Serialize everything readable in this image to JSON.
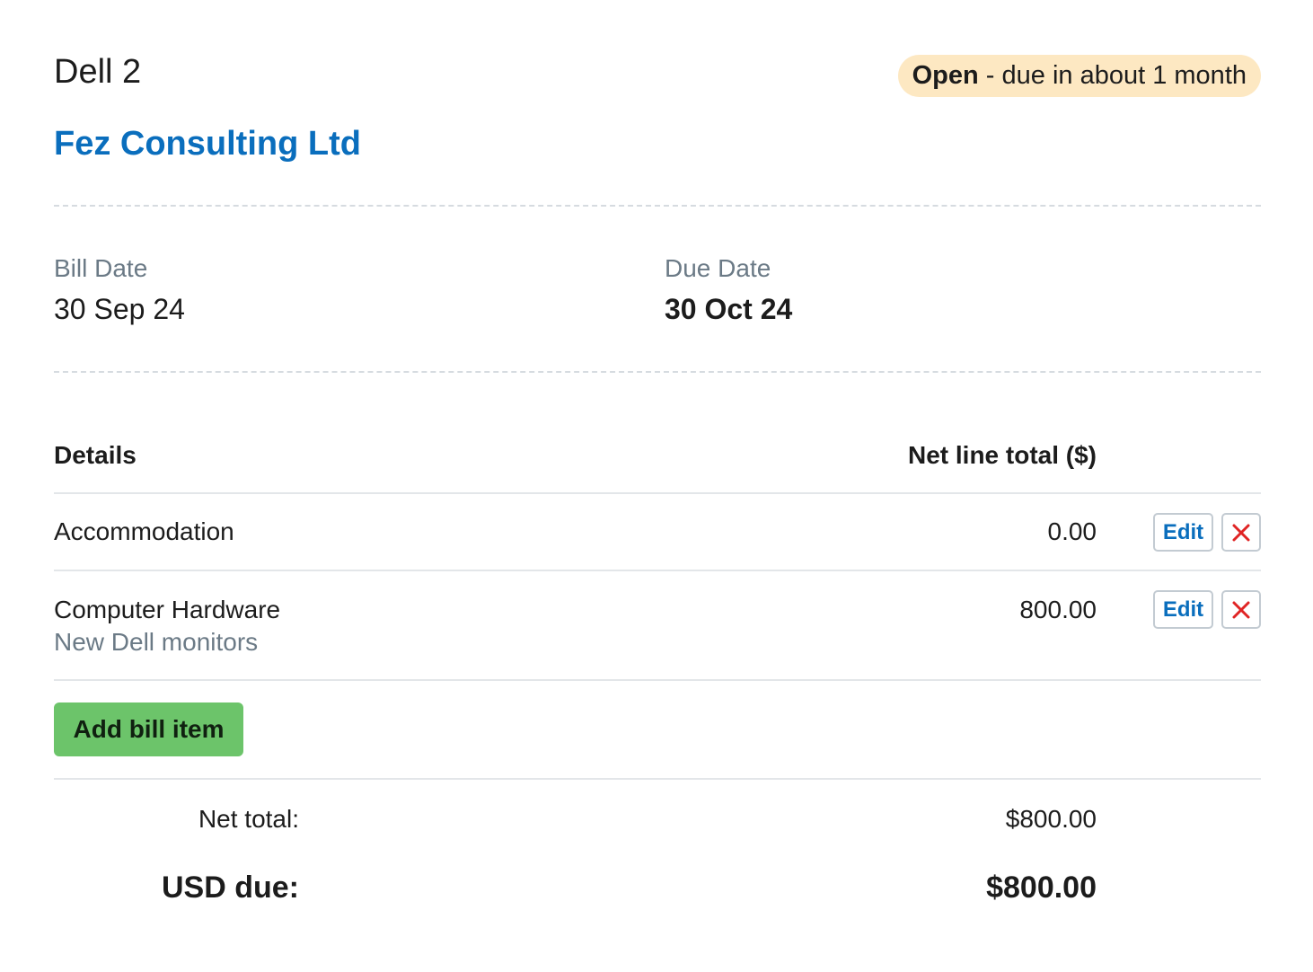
{
  "bill": {
    "title": "Dell 2",
    "status": {
      "label": "Open",
      "separator": " - ",
      "text": "due in about 1 month",
      "color": "#fde8c2"
    },
    "contact": "Fez Consulting Ltd"
  },
  "dates": {
    "bill_date_label": "Bill Date",
    "bill_date": "30 Sep 24",
    "due_date_label": "Due Date",
    "due_date": "30 Oct 24"
  },
  "table": {
    "headers": {
      "details": "Details",
      "net_line_total": "Net line total ($)"
    },
    "items": [
      {
        "name": "Accommodation",
        "description": "",
        "amount": "0.00"
      },
      {
        "name": "Computer Hardware",
        "description": "New Dell monitors",
        "amount": "800.00"
      }
    ],
    "edit_label": "Edit",
    "delete_icon": "close-icon"
  },
  "actions": {
    "add_item_label": "Add bill item"
  },
  "totals": {
    "net_label": "Net total:",
    "net_value": "$800.00",
    "due_label": "USD due:",
    "due_value": "$800.00"
  },
  "colors": {
    "link": "#0a6ebd",
    "add_button": "#6cc46a",
    "delete_icon": "#e02424"
  }
}
